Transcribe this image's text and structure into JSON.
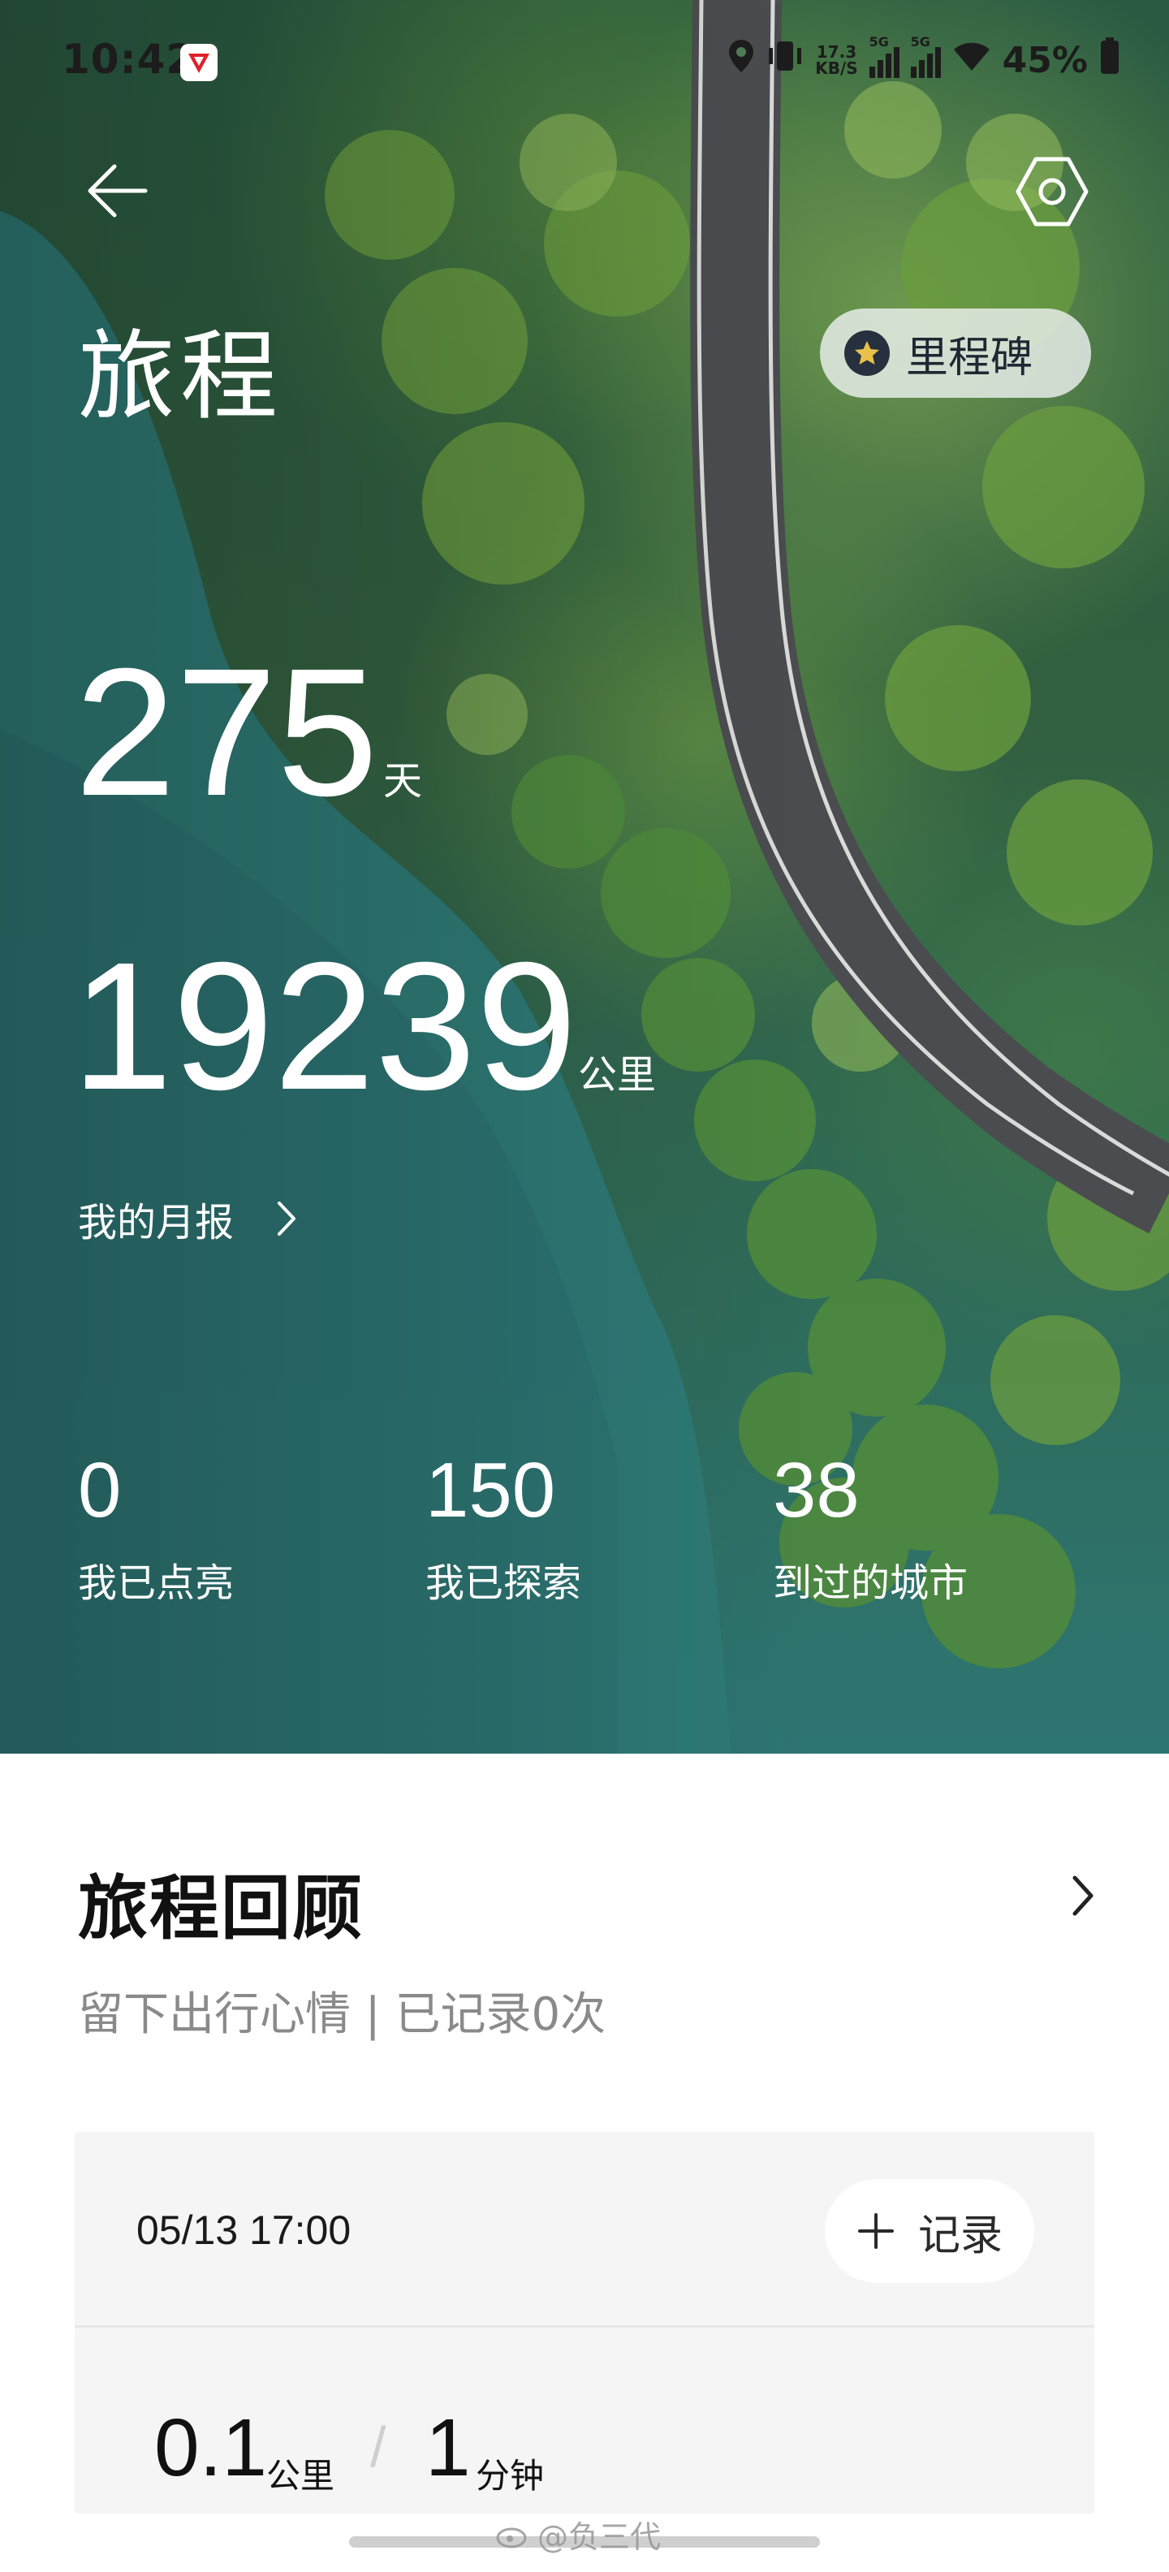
{
  "status_bar": {
    "time": "10:42",
    "net_speed_value": "17.3",
    "net_speed_unit": "KB/S",
    "sim1_label": "5G",
    "sim2_label": "5G",
    "battery": "45%"
  },
  "header": {
    "title": "旅程",
    "milestone_label": "里程碑"
  },
  "summary": {
    "days_value": "275",
    "days_unit": "天",
    "distance_value": "19239",
    "distance_unit": "公里",
    "monthly_report_label": "我的月报"
  },
  "stats": [
    {
      "value": "0",
      "label": "我已点亮"
    },
    {
      "value": "150",
      "label": "我已探索"
    },
    {
      "value": "38",
      "label": "到过的城市"
    }
  ],
  "review": {
    "title": "旅程回顾",
    "subtitle": "留下出行心情 | 已记录0次"
  },
  "trip": {
    "datetime": "05/13 17:00",
    "record_label": "记录",
    "distance_value": "0.1",
    "distance_unit": "公里",
    "separator": "/",
    "duration_value": "1",
    "duration_unit": "分钟"
  },
  "watermark": {
    "text": "@负三代"
  },
  "colors": {
    "water": "#2d7573",
    "forest": "#325f3f",
    "road": "#4a4c4f",
    "card_bg": "#f5f5f5"
  }
}
